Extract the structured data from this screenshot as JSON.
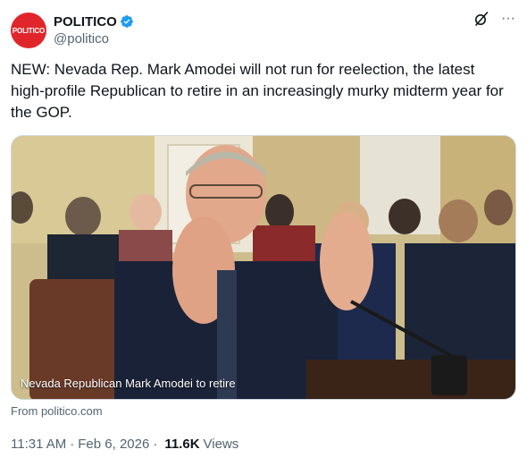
{
  "post": {
    "author": {
      "avatar_text": "POLITICO",
      "name": "POLITICO",
      "handle": "@politico",
      "verified": true,
      "brand_color": "#e0262a"
    },
    "actions": {
      "grok_icon": "grok-icon",
      "more_icon": "more-icon",
      "more_glyph": "···"
    },
    "text": "NEW: Nevada Rep. Mark Amodei will not run for reelection, the latest high-profile Republican to retire in an increasingly murky midterm year for the GOP.",
    "media": {
      "caption": "Nevada Republican Mark Amodei to retire"
    },
    "link_source": "From politico.com",
    "meta": {
      "time": "11:31 AM",
      "separator": "·",
      "date": "Feb 6, 2026",
      "views_count": "11.6K",
      "views_label": "Views"
    }
  }
}
